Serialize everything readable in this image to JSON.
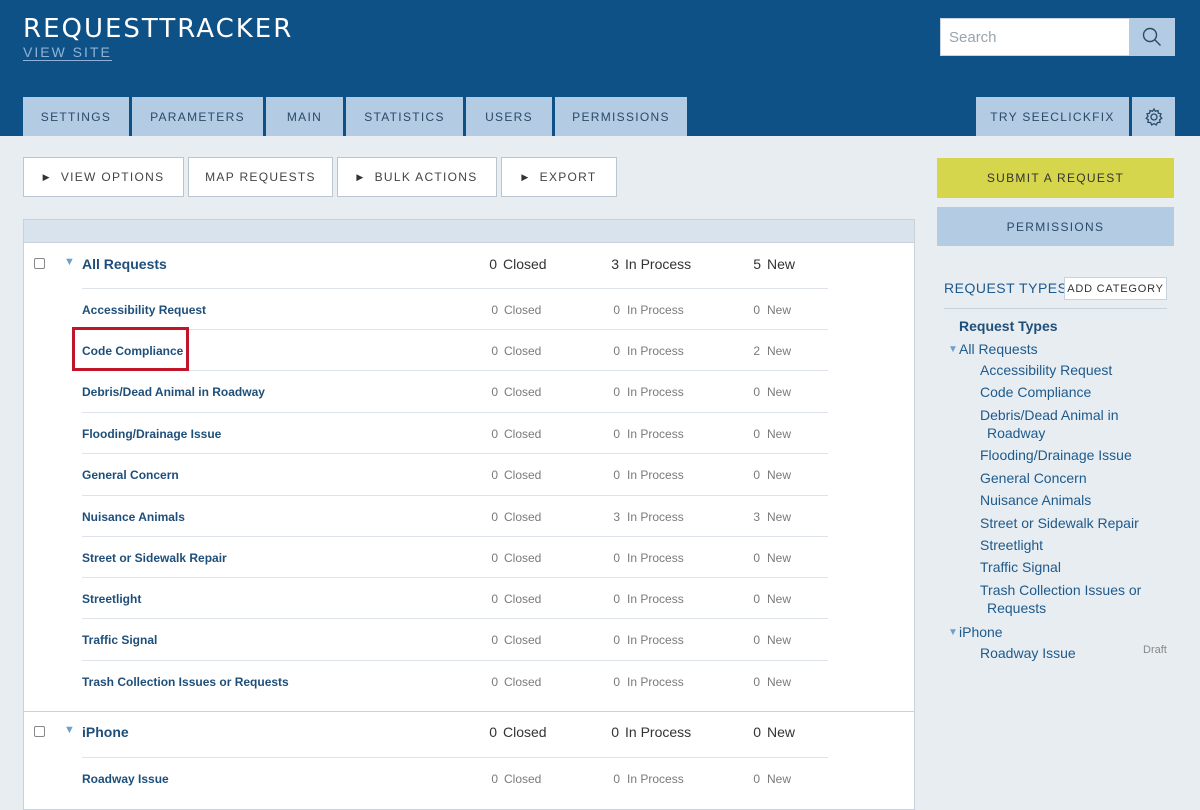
{
  "header": {
    "title": "REQUESTTRACKER",
    "view_site": "VIEW SITE",
    "search_placeholder": "Search",
    "tabs": [
      "SETTINGS",
      "PARAMETERS",
      "MAIN",
      "STATISTICS",
      "USERS",
      "PERMISSIONS"
    ],
    "try_label": "TRY SEECLICKFIX"
  },
  "toolbar": {
    "view_options": "VIEW OPTIONS",
    "map_requests": "MAP REQUESTS",
    "bulk_actions": "BULK ACTIONS",
    "export": "EXPORT"
  },
  "status_labels": {
    "closed": "Closed",
    "in_process": "In Process",
    "new": "New"
  },
  "groups": [
    {
      "name": "All Requests",
      "closed": "0",
      "in_process": "3",
      "new": "5",
      "items": [
        {
          "name": "Accessibility Request",
          "closed": "0",
          "in_process": "0",
          "new": "0"
        },
        {
          "name": "Code Compliance",
          "closed": "0",
          "in_process": "0",
          "new": "2"
        },
        {
          "name": "Debris/Dead Animal in Roadway",
          "closed": "0",
          "in_process": "0",
          "new": "0"
        },
        {
          "name": "Flooding/Drainage Issue",
          "closed": "0",
          "in_process": "0",
          "new": "0"
        },
        {
          "name": "General Concern",
          "closed": "0",
          "in_process": "0",
          "new": "0"
        },
        {
          "name": "Nuisance Animals",
          "closed": "0",
          "in_process": "3",
          "new": "3"
        },
        {
          "name": "Street or Sidewalk Repair",
          "closed": "0",
          "in_process": "0",
          "new": "0"
        },
        {
          "name": "Streetlight",
          "closed": "0",
          "in_process": "0",
          "new": "0"
        },
        {
          "name": "Traffic Signal",
          "closed": "0",
          "in_process": "0",
          "new": "0"
        },
        {
          "name": "Trash Collection Issues or Requests",
          "closed": "0",
          "in_process": "0",
          "new": "0"
        }
      ]
    },
    {
      "name": "iPhone",
      "closed": "0",
      "in_process": "0",
      "new": "0",
      "items": [
        {
          "name": "Roadway Issue",
          "closed": "0",
          "in_process": "0",
          "new": "0"
        }
      ]
    }
  ],
  "sidebar": {
    "submit": "SUBMIT A REQUEST",
    "permissions": "PERMISSIONS",
    "request_types_title": "REQUEST TYPES",
    "add_category": "ADD CATEGORY",
    "tree_heading": "Request Types",
    "tree": [
      {
        "group": "All Requests",
        "items": [
          [
            "Accessibility Request"
          ],
          [
            "Code Compliance"
          ],
          [
            "Debris/Dead Animal in",
            "Roadway"
          ],
          [
            "Flooding/Drainage Issue"
          ],
          [
            "General Concern"
          ],
          [
            "Nuisance Animals"
          ],
          [
            "Street or Sidewalk Repair"
          ],
          [
            "Streetlight"
          ],
          [
            "Traffic Signal"
          ],
          [
            "Trash Collection Issues or",
            "Requests"
          ]
        ]
      },
      {
        "group": "iPhone",
        "items": [
          [
            "Roadway Issue"
          ]
        ]
      }
    ],
    "draft_label": "Draft"
  },
  "colors": {
    "header_bg": "#0e5187",
    "tab_bg": "#b3cbe3",
    "submit_bg": "#d6d64c",
    "highlight_border": "#c0152a",
    "link": "#1e4f7a"
  }
}
